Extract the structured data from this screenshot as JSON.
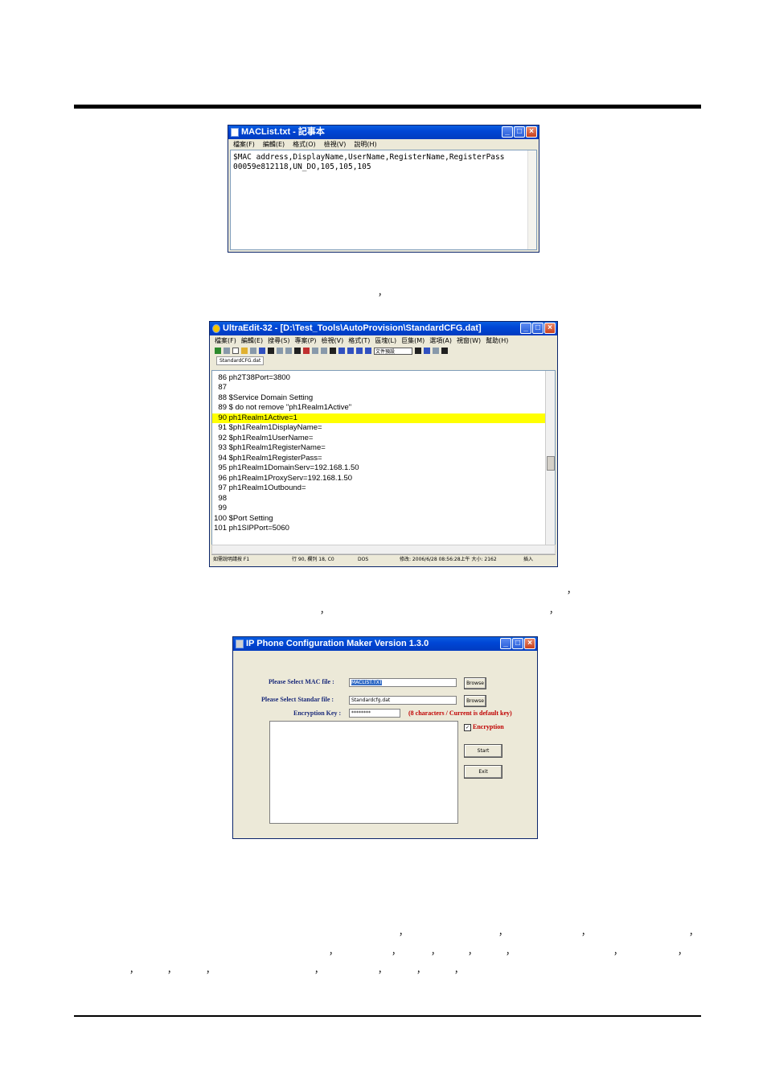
{
  "notepad": {
    "title": "MACList.txt - 記事本",
    "menu": [
      "檔案(F)",
      "編輯(E)",
      "格式(O)",
      "檢視(V)",
      "說明(H)"
    ],
    "lines": [
      "$MAC address,DisplayName,UserName,RegisterName,RegisterPass",
      "00059e812118,UN_DO,105,105,105"
    ]
  },
  "ultraedit": {
    "title": "UltraEdit-32 - [D:\\Test_Tools\\AutoProvision\\StandardCFG.dat]",
    "menu": [
      "檔案(F)",
      "編輯(E)",
      "搜尋(S)",
      "專案(P)",
      "檢視(V)",
      "格式(T)",
      "區塊(L)",
      "巨集(M)",
      "選項(A)",
      "視窗(W)",
      "幫助(H)"
    ],
    "encoding_select": "文件預設",
    "tab": "StandardCFG.dat",
    "lines": [
      {
        "num": "86",
        "text": "ph2T38Port=3800"
      },
      {
        "num": "87",
        "text": ""
      },
      {
        "num": "88",
        "text": "$Service Domain Setting"
      },
      {
        "num": "89",
        "text": "$ do not remove \"ph1Realm1Active\""
      },
      {
        "num": "90",
        "text": "ph1Realm1Active=1"
      },
      {
        "num": "91",
        "text": "$ph1Realm1DisplayName="
      },
      {
        "num": "92",
        "text": "$ph1Realm1UserName="
      },
      {
        "num": "93",
        "text": "$ph1Realm1RegisterName="
      },
      {
        "num": "94",
        "text": "$ph1Realm1RegisterPass="
      },
      {
        "num": "95",
        "text": "ph1Realm1DomainServ=192.168.1.50"
      },
      {
        "num": "96",
        "text": "ph1Realm1ProxyServ=192.168.1.50"
      },
      {
        "num": "97",
        "text": "ph1Realm1Outbound="
      },
      {
        "num": "98",
        "text": ""
      },
      {
        "num": "99",
        "text": ""
      },
      {
        "num": "100",
        "text": "$Port Setting"
      },
      {
        "num": "101",
        "text": "ph1SIPPort=5060"
      }
    ],
    "highlighted_line": "90",
    "status": {
      "help": "如需說明請按 F1",
      "position": "行 90, 欄列 18, C0",
      "format": "DOS",
      "modified": "修改: 2006/6/28 08:56:28上午 大小: 2162",
      "mode": "插入"
    }
  },
  "ipmaker": {
    "title": "IP Phone Configuration Maker Version 1.3.0",
    "mac_label": "Please Select MAC file :",
    "mac_value": "MACLIST.TXT",
    "std_label": "Please Select Standar file :",
    "std_value": "Standardcfg.dat",
    "key_label": "Encryption Key :",
    "key_value": "********",
    "key_note": "(8 characters / Current is default key)",
    "browse1": "Browse",
    "browse2": "Browse",
    "encryption_label": "Encryption",
    "encryption_checked": "✓",
    "start": "Start",
    "exit": "Exit"
  },
  "doc": {
    "comma": "，"
  }
}
